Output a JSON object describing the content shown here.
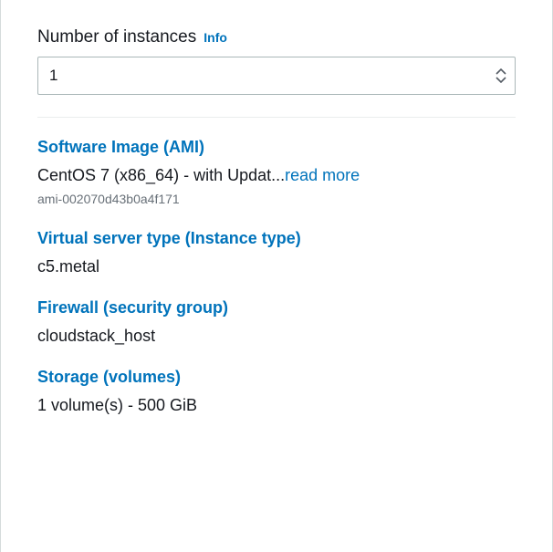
{
  "instanceCount": {
    "label": "Number of instances",
    "infoLabel": "Info",
    "value": "1"
  },
  "sections": {
    "ami": {
      "title": "Software Image (AMI)",
      "value": "CentOS 7 (x86_64) - with Updat...",
      "readMore": "read more",
      "amiId": "ami-002070d43b0a4f171"
    },
    "instanceType": {
      "title": "Virtual server type (Instance type)",
      "value": "c5.metal"
    },
    "securityGroup": {
      "title": "Firewall (security group)",
      "value": "cloudstack_host"
    },
    "storage": {
      "title": "Storage (volumes)",
      "value": "1 volume(s) - 500 GiB"
    }
  }
}
